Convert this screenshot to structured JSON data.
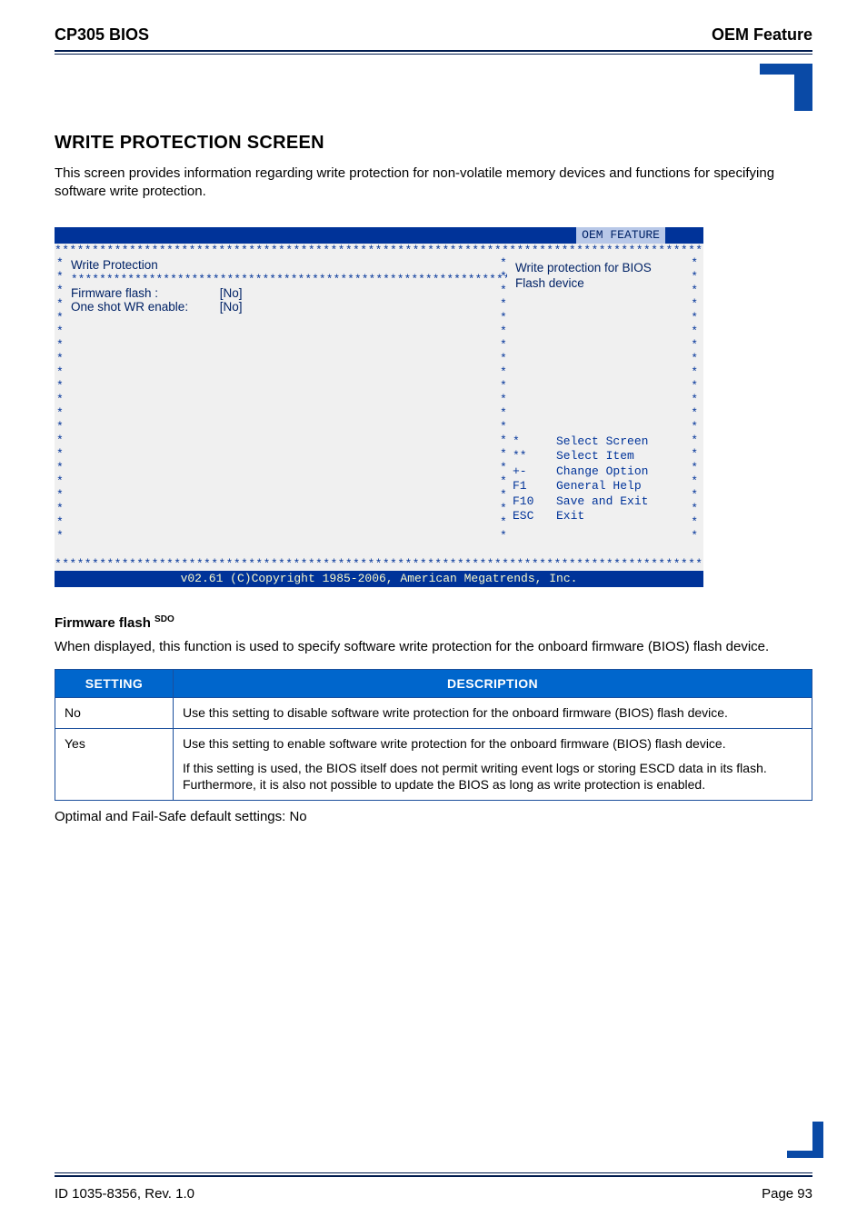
{
  "header": {
    "left": "CP305 BIOS",
    "right": "OEM Feature"
  },
  "section": {
    "title": "WRITE PROTECTION SCREEN",
    "intro": "This screen provides information regarding write protection for non-volatile memory devices and functions for specifying software write protection."
  },
  "bios": {
    "titlebar_label": "OEM FEATURE",
    "left_title": "Write Protection",
    "rows": [
      {
        "label": "Firmware flash      :",
        "value": "[No]"
      },
      {
        "label": "One shot WR enable:",
        "value": "[No]"
      }
    ],
    "right_desc": [
      "Write protection for BIOS",
      "Flash device"
    ],
    "nav": [
      {
        "key": "*",
        "label": "Select Screen"
      },
      {
        "key": "**",
        "label": "Select Item"
      },
      {
        "key": "+-",
        "label": "Change Option"
      },
      {
        "key": "F1",
        "label": "General Help"
      },
      {
        "key": "F10",
        "label": "Save and Exit"
      },
      {
        "key": "ESC",
        "label": "Exit"
      }
    ],
    "footer": "v02.61 (C)Copyright 1985-2006, American Megatrends, Inc."
  },
  "subsection": {
    "title": "Firmware flash",
    "sup": "SDO"
  },
  "subsection_intro": "When displayed, this function is used to specify software write protection for the onboard firmware (BIOS) flash device.",
  "table": {
    "headers": [
      "SETTING",
      "DESCRIPTION"
    ],
    "rows": [
      {
        "setting": "No",
        "description": [
          "Use this setting to disable software write protection for the onboard firmware (BIOS) flash device."
        ]
      },
      {
        "setting": "Yes",
        "description": [
          "Use this setting to enable software write protection for the onboard firmware (BIOS) flash device.",
          "If this setting is used, the BIOS itself does not permit writing event logs or storing ESCD data in its flash. Furthermore, it is also not possible to update the BIOS as long as write protection is enabled."
        ]
      }
    ]
  },
  "defaults_note": "Optimal and Fail-Safe default settings: No",
  "footer": {
    "left": "ID 1035-8356, Rev. 1.0",
    "right": "Page 93"
  }
}
